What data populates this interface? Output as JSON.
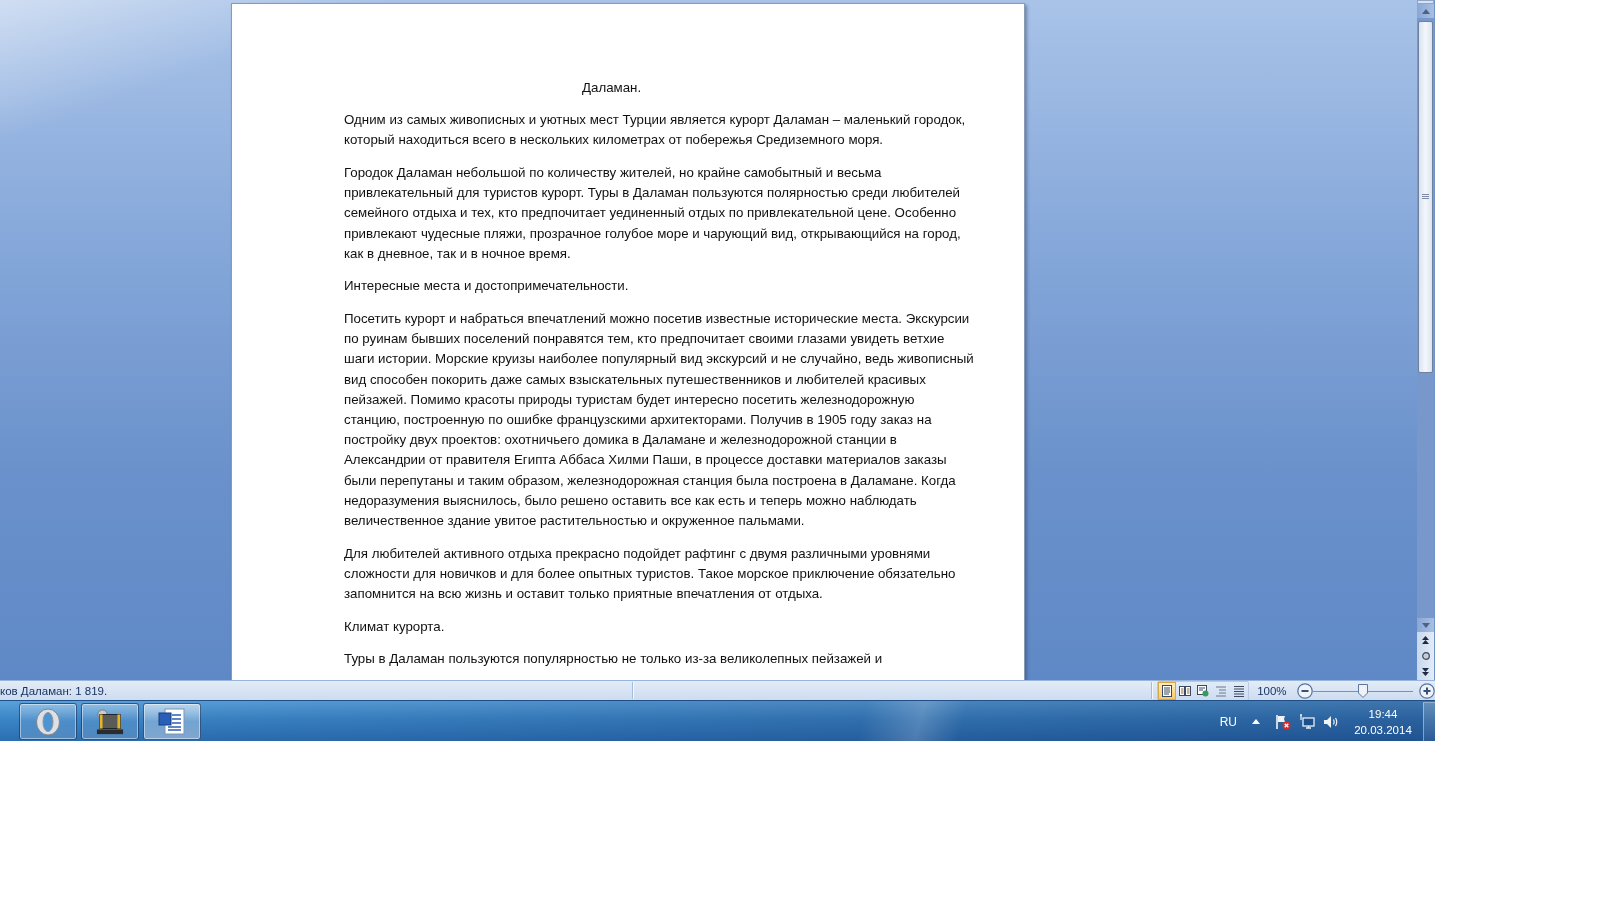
{
  "document": {
    "title": "Даламан.",
    "paragraphs": [
      "Одним из самых живописных и уютных мест Турции является курорт Даламан – маленький городок, который находиться всего в нескольких километрах от побережья Средиземного моря.",
      "Городок Даламан небольшой по количеству жителей, но крайне самобытный и весьма привлекательный для туристов курорт. Туры в Даламан пользуются полярностью среди любителей семейного отдыха и тех, кто предпочитает уединенный отдых по привлекательной цене. Особенно привлекают чудесные пляжи, прозрачное голубое море и чарующий вид, открывающийся на город, как в дневное, так и в ночное время.",
      "Интересные места и достопримечательности.",
      "Посетить курорт и набраться впечатлений можно посетив известные исторические места. Экскурсии по руинам бывших поселений понравятся тем, кто предпочитает своими глазами увидеть ветхие шаги истории. Морские круизы наиболее популярный вид экскурсий и не случайно, ведь живописный вид способен покорить даже самых взыскательных путешественников и любителей красивых пейзажей. Помимо красоты природы туристам будет интересно посетить железнодорожную станцию, построенную по ошибке французскими архитекторами. Получив в 1905 году заказ на постройку двух проектов: охотничьего домика в Даламане и железнодорожной станции в Александрии от правителя Египта Аббаса Хилми Паши, в процессе доставки материалов заказы были перепутаны и таким образом, железнодорожная станция была построена в Даламане. Когда недоразумения выяснилось, было решено оставить все как есть и теперь можно наблюдать величественное здание увитое растительностью и окруженное пальмами.",
      "Для любителей активного отдыха прекрасно подойдет рафтинг с двумя различными уровнями сложности для новичков и для более опытных туристов. Такое морское приключение обязательно запомнится на всю жизнь и оставит только приятные впечатления от отдыха.",
      "Климат курорта.",
      "Туры в Даламан пользуются популярностью не только из-за великолепных пейзажей и"
    ]
  },
  "status_bar": {
    "word_count": "ков Даламан: 1 819.",
    "views": [
      {
        "selected": true
      },
      {
        "selected": false
      },
      {
        "selected": false
      },
      {
        "selected": false
      },
      {
        "selected": false
      }
    ],
    "zoom_label": "100%",
    "zoom": {
      "level": 0.5
    }
  },
  "taskbar": {
    "buttons": [
      {
        "selected": false
      },
      {
        "selected": false
      },
      {
        "selected": true
      }
    ],
    "language": "RU",
    "time": "19:44",
    "date": "20.03.2014"
  }
}
